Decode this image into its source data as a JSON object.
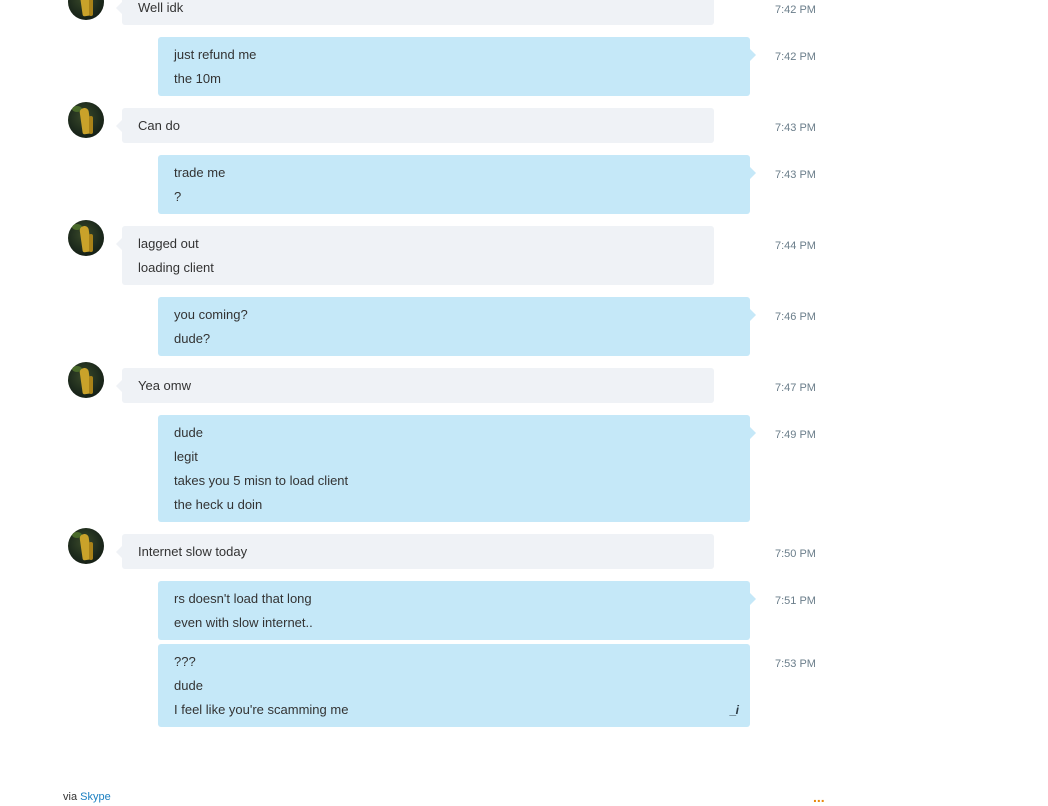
{
  "messages": [
    {
      "sender": "them",
      "time": "7:42 PM",
      "lines": [
        "Well idk"
      ]
    },
    {
      "sender": "me",
      "time": "7:42 PM",
      "lines": [
        "just refund me",
        "the 10m"
      ]
    },
    {
      "sender": "them",
      "time": "7:43 PM",
      "lines": [
        "Can do"
      ]
    },
    {
      "sender": "me",
      "time": "7:43 PM",
      "lines": [
        "trade me",
        "?"
      ]
    },
    {
      "sender": "them",
      "time": "7:44 PM",
      "lines": [
        "lagged out",
        "loading client"
      ]
    },
    {
      "sender": "me",
      "time": "7:46 PM",
      "lines": [
        "you coming?",
        "dude?"
      ]
    },
    {
      "sender": "them",
      "time": "7:47 PM",
      "lines": [
        "Yea omw"
      ]
    },
    {
      "sender": "me",
      "time": "7:49 PM",
      "lines": [
        "dude",
        "legit",
        "takes you 5 misn to load client",
        "the heck u doin"
      ]
    },
    {
      "sender": "them",
      "time": "7:50 PM",
      "lines": [
        "Internet slow today"
      ]
    },
    {
      "sender": "me",
      "time": "7:51 PM",
      "lines": [
        "rs doesn't load that long",
        "even with slow internet.."
      ]
    },
    {
      "sender": "me",
      "time": "7:53 PM",
      "lines": [
        "???",
        "dude",
        "I feel like you're scamming me"
      ],
      "edited": true
    }
  ],
  "edit_icon": "_i",
  "footer": {
    "via_label": "via",
    "link_label": "Skype",
    "more_icon": "..."
  },
  "colors": {
    "incoming_bubble": "#eff2f6",
    "outgoing_bubble": "#c5e8f8",
    "link": "#1a7fc1",
    "more_icon": "#e8890c"
  }
}
